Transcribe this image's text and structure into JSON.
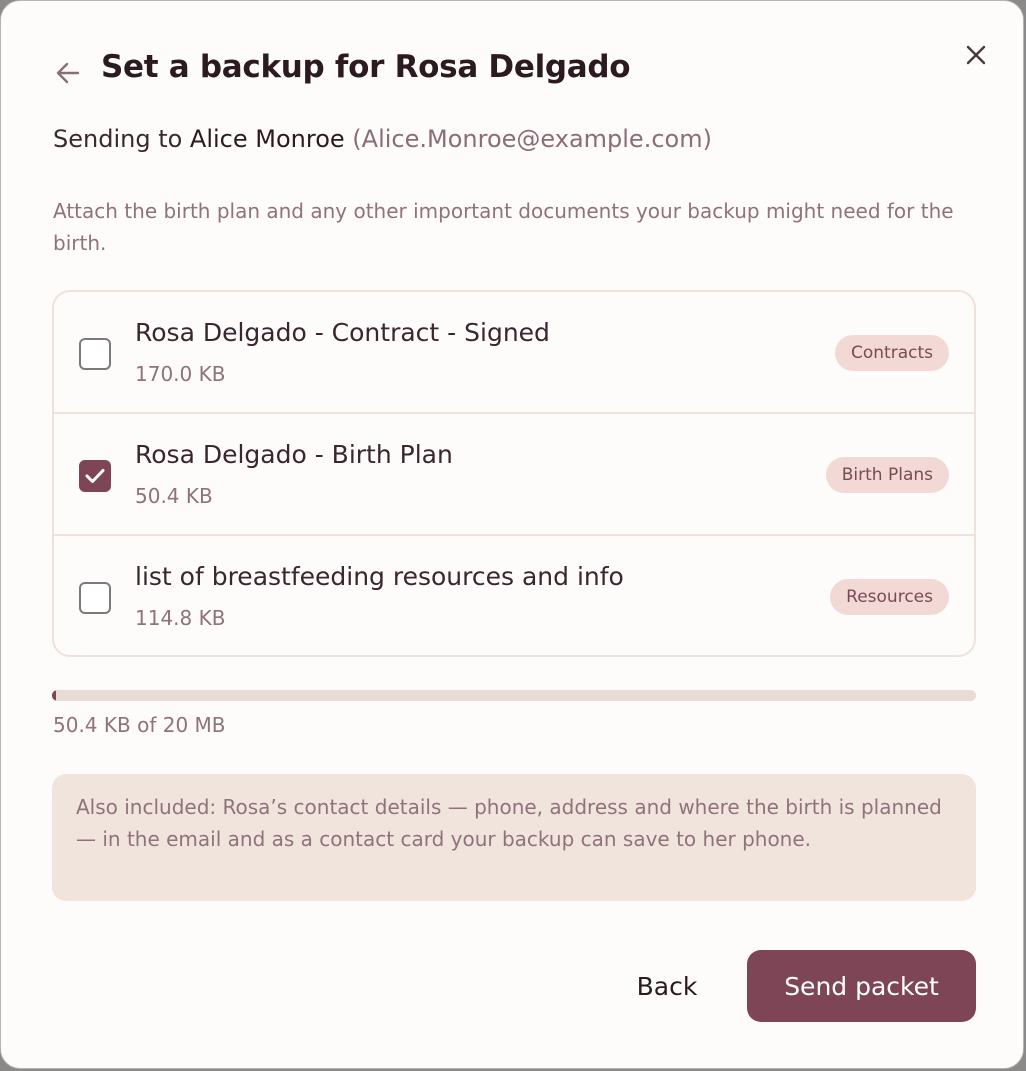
{
  "dialog": {
    "title": "Set a backup for Rosa Delgado",
    "back_icon": "arrow-left-icon",
    "close_icon": "close-icon"
  },
  "recipient": {
    "prefix": "Sending to",
    "name": "Alice Monroe",
    "email": "(Alice.Monroe@example.com)"
  },
  "instructions": "Attach the birth plan and any other important documents your backup might need for the birth.",
  "documents": [
    {
      "name": "Rosa Delgado - Contract - Signed",
      "size": "170.0 KB",
      "category": "Contracts",
      "checked": false
    },
    {
      "name": "Rosa Delgado - Birth Plan",
      "size": "50.4 KB",
      "category": "Birth Plans",
      "checked": true
    },
    {
      "name": "list of breastfeeding resources and info",
      "size": "114.8 KB",
      "category": "Resources",
      "checked": false
    }
  ],
  "storage": {
    "used_fraction": 0.0025,
    "label": "50.4 KB of 20 MB"
  },
  "info_note": "Also included: Rosa’s contact details — phone, address and where the birth is planned — in the email and as a contact card your backup can save to her phone.",
  "actions": {
    "back_label": "Back",
    "send_label": "Send packet"
  },
  "colors": {
    "accent": "#7d4556",
    "badge_bg": "#f2d9d6",
    "info_bg": "#f1e4dd",
    "muted_text": "#8f727c"
  }
}
